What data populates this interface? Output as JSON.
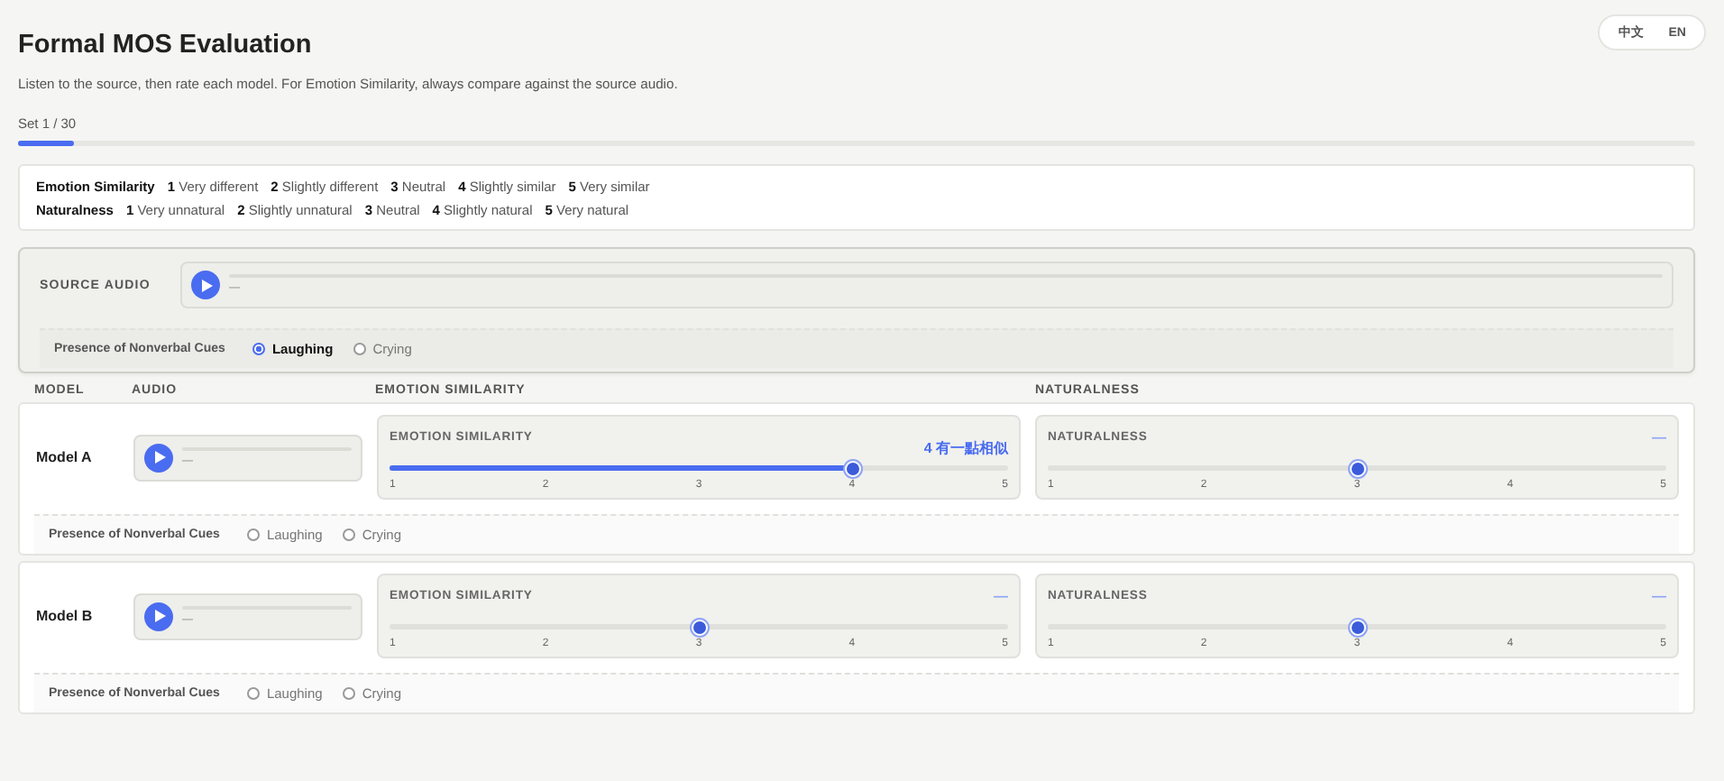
{
  "header": {
    "title": "Formal MOS Evaluation",
    "subtitle": "Listen to the source, then rate each model. For Emotion Similarity, always compare against the source audio.",
    "languages": [
      {
        "label": "中文",
        "selected": false
      },
      {
        "label": "EN",
        "selected": false
      }
    ]
  },
  "progress": {
    "label": "Set 1 / 30",
    "level": 0.033
  },
  "legend": [
    {
      "title": "Emotion Similarity",
      "items": [
        {
          "num": "1",
          "text": "Very different"
        },
        {
          "num": "2",
          "text": "Slightly different"
        },
        {
          "num": "3",
          "text": "Neutral"
        },
        {
          "num": "4",
          "text": "Slightly similar"
        },
        {
          "num": "5",
          "text": "Very similar"
        }
      ]
    },
    {
      "title": "Naturalness",
      "items": [
        {
          "num": "1",
          "text": "Very unnatural"
        },
        {
          "num": "2",
          "text": "Slightly unnatural"
        },
        {
          "num": "3",
          "text": "Neutral"
        },
        {
          "num": "4",
          "text": "Slightly natural"
        },
        {
          "num": "5",
          "text": "Very natural"
        }
      ]
    }
  ],
  "source": {
    "label": "SOURCE AUDIO",
    "player": {
      "time": "—"
    },
    "nonverbal": {
      "label": "Presence of Nonverbal Cues",
      "options": [
        {
          "label": "Laughing",
          "selected": true
        },
        {
          "label": "Crying",
          "selected": false
        }
      ]
    }
  },
  "table": {
    "columns": [
      "MODEL",
      "AUDIO",
      "EMOTION SIMILARITY",
      "NATURALNESS"
    ],
    "rows": [
      {
        "model": "Model A",
        "player": {
          "time": "—"
        },
        "ratings": [
          {
            "label": "EMOTION SIMILARITY",
            "reading": "4 有一點相似",
            "set": true,
            "level": 0.75,
            "ticks": [
              "1",
              "2",
              "3",
              "4",
              "5"
            ]
          },
          {
            "label": "NATURALNESS",
            "reading": "—",
            "set": false,
            "level": 0.5,
            "ticks": [
              "1",
              "2",
              "3",
              "4",
              "5"
            ]
          }
        ],
        "nonverbal": {
          "label": "Presence of Nonverbal Cues",
          "options": [
            {
              "label": "Laughing",
              "selected": false
            },
            {
              "label": "Crying",
              "selected": false
            }
          ]
        }
      },
      {
        "model": "Model B",
        "player": {
          "time": "—"
        },
        "ratings": [
          {
            "label": "EMOTION SIMILARITY",
            "reading": "—",
            "set": false,
            "level": 0.5,
            "ticks": [
              "1",
              "2",
              "3",
              "4",
              "5"
            ]
          },
          {
            "label": "NATURALNESS",
            "reading": "—",
            "set": false,
            "level": 0.5,
            "ticks": [
              "1",
              "2",
              "3",
              "4",
              "5"
            ]
          }
        ],
        "nonverbal": {
          "label": "Presence of Nonverbal Cues",
          "options": [
            {
              "label": "Laughing",
              "selected": false
            },
            {
              "label": "Crying",
              "selected": false
            }
          ]
        }
      }
    ]
  }
}
